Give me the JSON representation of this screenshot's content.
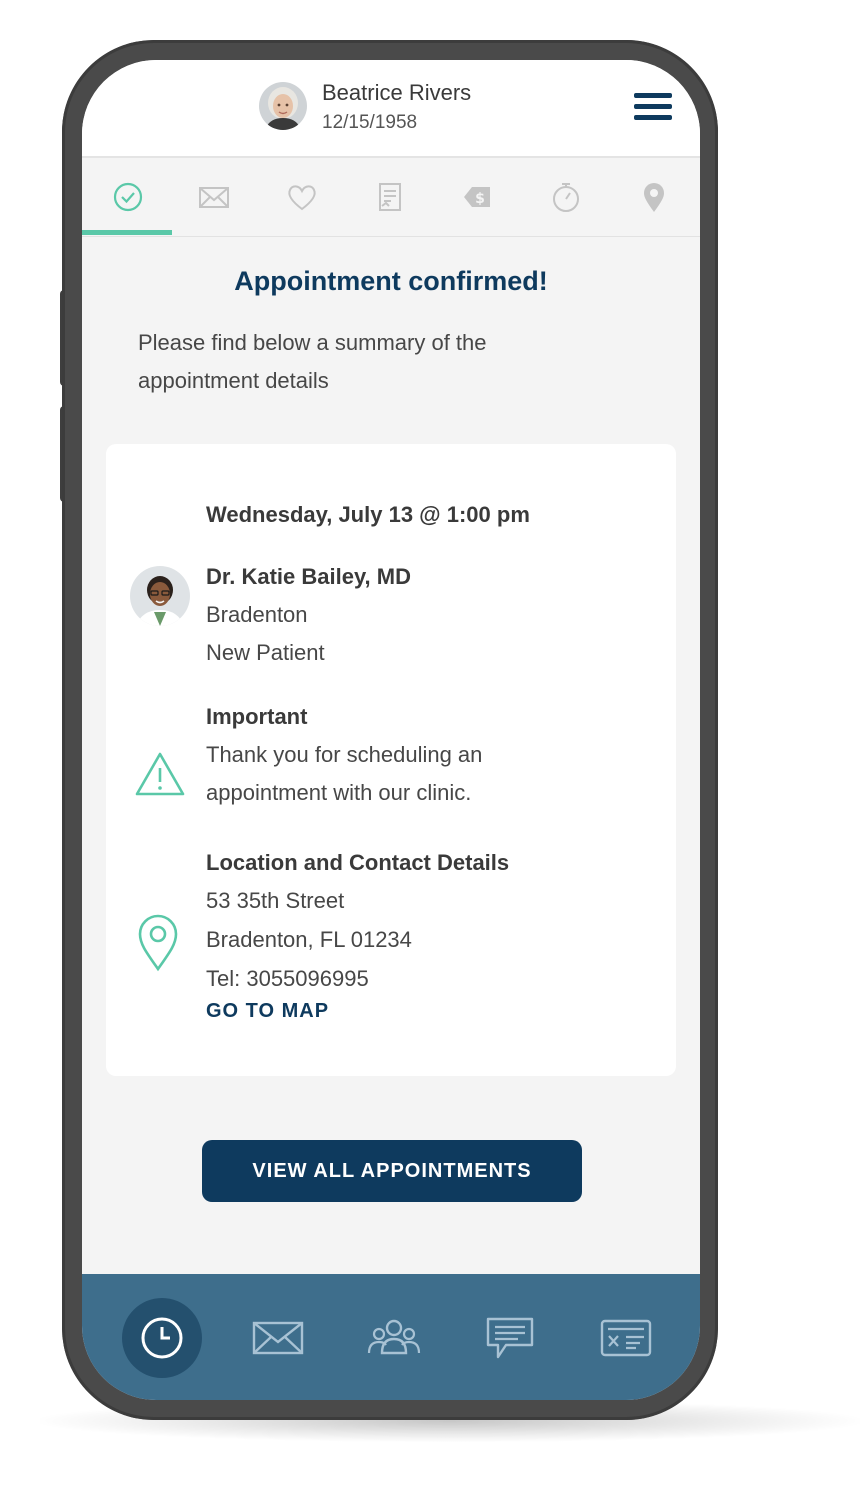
{
  "header": {
    "patient_name": "Beatrice Rivers",
    "patient_dob": "12/15/1958",
    "menu_icon": "hamburger-menu-icon"
  },
  "tabs": [
    {
      "icon": "check-circle-icon",
      "active": true
    },
    {
      "icon": "envelope-icon",
      "active": false
    },
    {
      "icon": "heart-icon",
      "active": false
    },
    {
      "icon": "document-icon",
      "active": false
    },
    {
      "icon": "dollar-tag-icon",
      "active": false
    },
    {
      "icon": "stopwatch-icon",
      "active": false
    },
    {
      "icon": "location-pin-icon",
      "active": false
    }
  ],
  "main": {
    "title": "Appointment confirmed!",
    "subtitle": "Please find below a summary of the appointment details"
  },
  "card": {
    "date": "Wednesday, July 13 @ 1:00 pm",
    "doctor_name": "Dr. Katie Bailey, MD",
    "doctor_location": "Bradenton",
    "patient_type": "New Patient",
    "important_title": "Important",
    "important_text": "Thank you for scheduling an appointment with our clinic.",
    "location_title": "Location and Contact Details",
    "address_line1": "53 35th Street",
    "address_line2": "Bradenton, FL 01234",
    "tel": "Tel: 3055096995",
    "go_to_map": "GO TO MAP"
  },
  "actions": {
    "view_all": "VIEW ALL APPOINTMENTS"
  },
  "bottom_nav": [
    {
      "icon": "clock-icon",
      "active": true
    },
    {
      "icon": "mail-icon",
      "active": false
    },
    {
      "icon": "group-icon",
      "active": false
    },
    {
      "icon": "chat-icon",
      "active": false
    },
    {
      "icon": "id-card-icon",
      "active": false
    }
  ],
  "colors": {
    "primary": "#0e3a5e",
    "accent": "#5ac8a8",
    "nav_bg": "#3e6e8c"
  }
}
